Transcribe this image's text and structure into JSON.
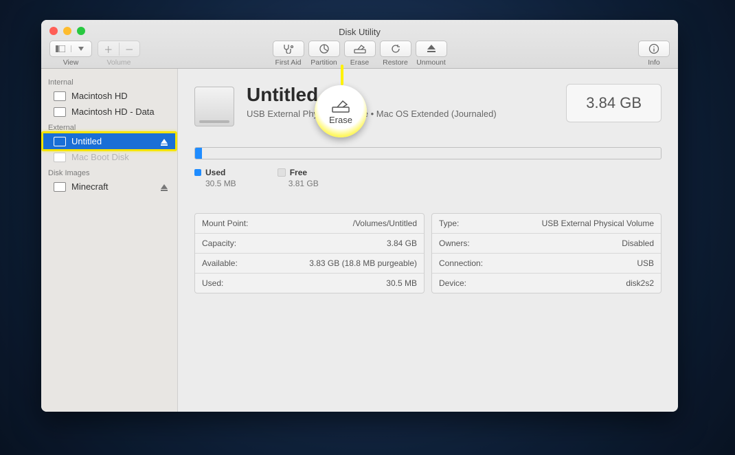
{
  "window": {
    "title": "Disk Utility"
  },
  "toolbar": {
    "view": "View",
    "volume": "Volume",
    "first_aid": "First Aid",
    "partition": "Partition",
    "erase": "Erase",
    "restore": "Restore",
    "unmount": "Unmount",
    "info": "Info"
  },
  "callout": {
    "label": "Erase"
  },
  "sidebar": {
    "internal_label": "Internal",
    "external_label": "External",
    "disk_images_label": "Disk Images",
    "internal": [
      {
        "name": "Macintosh HD"
      },
      {
        "name": "Macintosh HD - Data"
      }
    ],
    "external": [
      {
        "name": "Untitled"
      },
      {
        "name": "Mac Boot Disk"
      }
    ],
    "disk_images": [
      {
        "name": "Minecraft"
      }
    ]
  },
  "volume": {
    "name": "Untitled",
    "subtitle": "USB External Physical Volume • Mac OS Extended (Journaled)",
    "size": "3.84 GB",
    "used_label": "Used",
    "used_value": "30.5 MB",
    "free_label": "Free",
    "free_value": "3.81 GB",
    "used_percent": 1.5
  },
  "info_left": [
    {
      "k": "Mount Point:",
      "v": "/Volumes/Untitled"
    },
    {
      "k": "Capacity:",
      "v": "3.84 GB"
    },
    {
      "k": "Available:",
      "v": "3.83 GB (18.8 MB purgeable)"
    },
    {
      "k": "Used:",
      "v": "30.5 MB"
    }
  ],
  "info_right": [
    {
      "k": "Type:",
      "v": "USB External Physical Volume"
    },
    {
      "k": "Owners:",
      "v": "Disabled"
    },
    {
      "k": "Connection:",
      "v": "USB"
    },
    {
      "k": "Device:",
      "v": "disk2s2"
    }
  ]
}
